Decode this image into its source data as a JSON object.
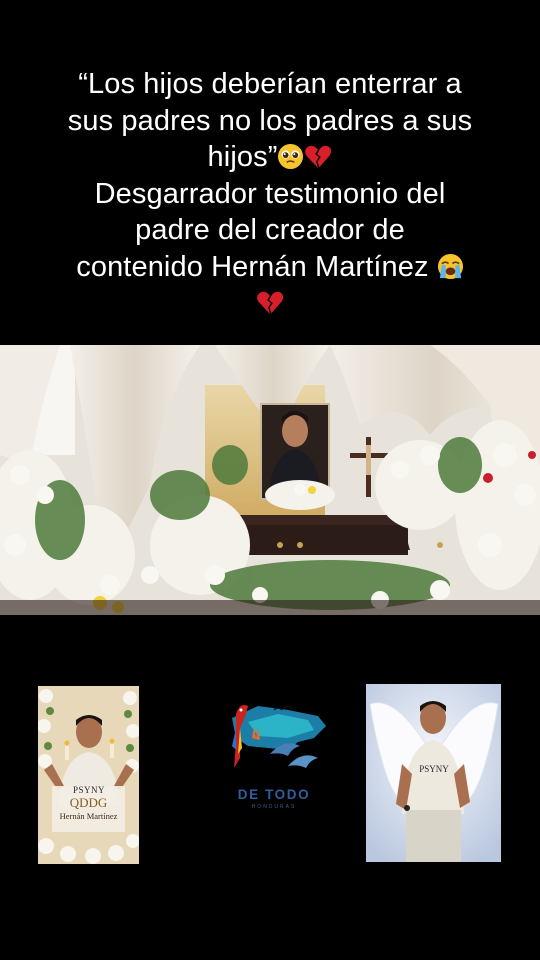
{
  "caption": {
    "line1": "“Los hijos deberían enterrar a",
    "line2": "sus padres no los padres a sus",
    "line3": "hijos”",
    "line4": "Desgarrador testimonio del",
    "line5": "padre del creador de",
    "line6": "contenido Hernán Martínez",
    "emojis": [
      "pleading-face",
      "broken-heart",
      "loudly-crying-face",
      "broken-heart"
    ]
  },
  "memorial_card": {
    "shirt_text": "PSYNY",
    "title": "QDDG",
    "name": "Hernán Martínez"
  },
  "logo": {
    "brand": "DE TODO",
    "subtitle": "HONDURAS"
  },
  "angel_photo": {
    "shirt_text": "PSYNY"
  },
  "colors": {
    "background": "#000000",
    "caption_text": "#ffffff",
    "logo_blue": "#2f5f9e"
  }
}
